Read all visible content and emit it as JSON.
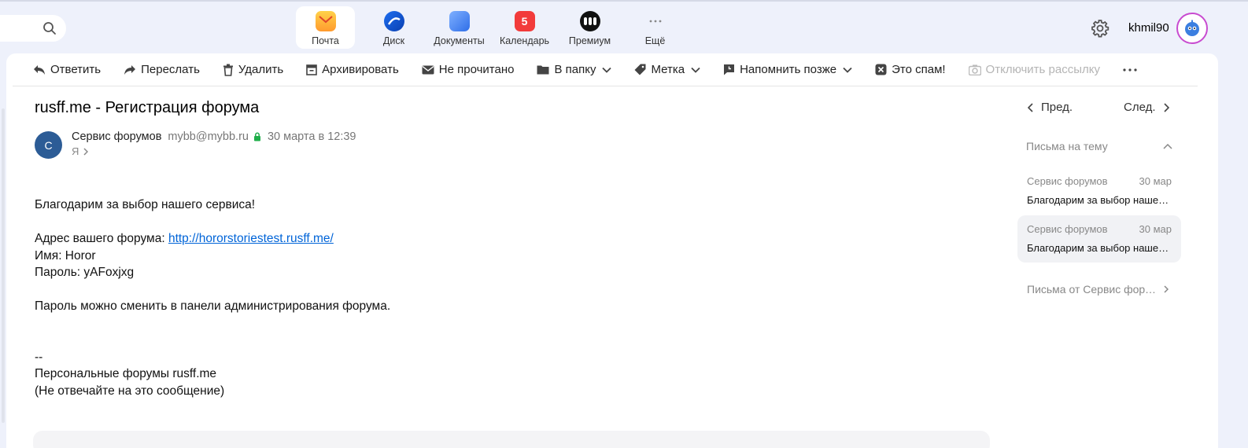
{
  "header": {
    "apps": [
      {
        "label": "Почта",
        "icon": "mail-icon",
        "active": true
      },
      {
        "label": "Диск",
        "icon": "disk-icon"
      },
      {
        "label": "Документы",
        "icon": "documents-icon"
      },
      {
        "label": "Календарь",
        "icon": "calendar-icon",
        "badge": "5"
      },
      {
        "label": "Премиум",
        "icon": "premium-icon"
      },
      {
        "label": "Ещё",
        "icon": "more-icon"
      }
    ],
    "username": "khmil90"
  },
  "toolbar": {
    "reply": "Ответить",
    "forward": "Переслать",
    "delete": "Удалить",
    "archive": "Архивировать",
    "unread": "Не прочитано",
    "to_folder": "В папку",
    "label": "Метка",
    "remind_later": "Напомнить позже",
    "spam": "Это спам!",
    "unsubscribe": "Отключить рассылку"
  },
  "message": {
    "subject": "rusff.me - Регистрация форума",
    "sender_initial": "С",
    "sender_name": "Сервис форумов",
    "sender_email": "mybb@mybb.ru",
    "date": "30 марта в 12:39",
    "recipient": "Я",
    "body": {
      "line1": "Благодарим за выбор нашего сервиса!",
      "address_label": "Адрес вашего форума: ",
      "address_link": "http://hororstoriestest.rusff.me/",
      "name_line": "Имя: Horor",
      "password_line": "Пароль: yAFoxjxg",
      "change_line": "Пароль можно сменить в панели администрирования форума.",
      "sig_sep": "--",
      "sig1": "Персональные форумы rusff.me",
      "sig2": "(Не отвечайте на это сообщение)"
    }
  },
  "sidebar": {
    "prev": "Пред.",
    "next": "След.",
    "thread_title": "Письма на тему",
    "thread_items": [
      {
        "from": "Сервис форумов",
        "date": "30 мар",
        "subject": "Благодарим за выбор нашего сервиса!"
      },
      {
        "from": "Сервис форумов",
        "date": "30 мар",
        "subject": "Благодарим за выбор нашего сервиса!"
      }
    ],
    "from_more": "Письма от Сервис форумов"
  }
}
